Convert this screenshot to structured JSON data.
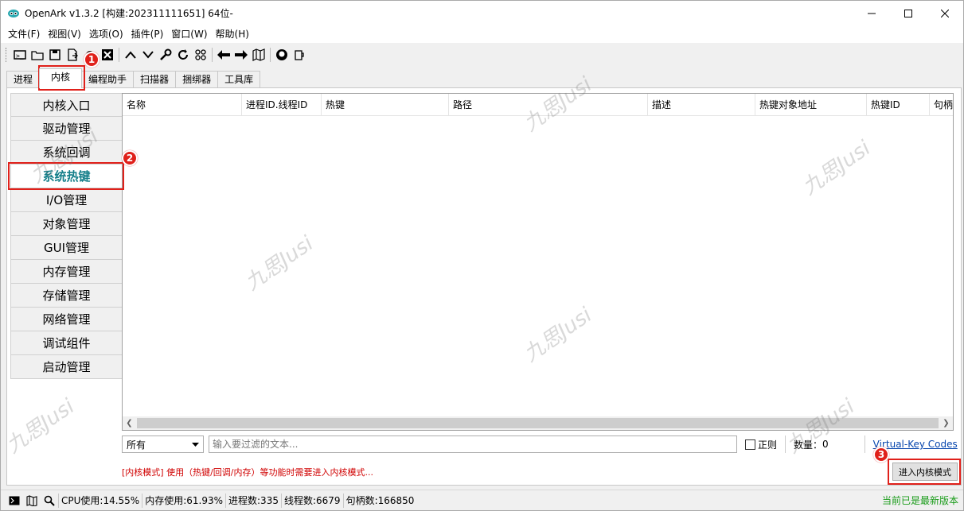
{
  "window": {
    "title": "OpenArk v1.3.2 [构建:202311111651]  64位-"
  },
  "menu": [
    {
      "label": "文件(F)"
    },
    {
      "label": "视图(V)"
    },
    {
      "label": "选项(O)"
    },
    {
      "label": "插件(P)"
    },
    {
      "label": "窗口(W)"
    },
    {
      "label": "帮助(H)"
    }
  ],
  "tabs": [
    {
      "label": "进程"
    },
    {
      "label": "内核"
    },
    {
      "label": "编程助手"
    },
    {
      "label": "扫描器"
    },
    {
      "label": "捆绑器"
    },
    {
      "label": "工具库"
    }
  ],
  "sidenav": [
    {
      "label": "内核入口"
    },
    {
      "label": "驱动管理"
    },
    {
      "label": "系统回调"
    },
    {
      "label": "系统热键"
    },
    {
      "label": "I/O管理"
    },
    {
      "label": "对象管理"
    },
    {
      "label": "GUI管理"
    },
    {
      "label": "内存管理"
    },
    {
      "label": "存储管理"
    },
    {
      "label": "网络管理"
    },
    {
      "label": "调试组件"
    },
    {
      "label": "启动管理"
    }
  ],
  "table": {
    "columns": [
      "名称",
      "进程ID.线程ID",
      "热键",
      "路径",
      "描述",
      "热键对象地址",
      "热键ID",
      "句柄"
    ]
  },
  "filter": {
    "select_value": "所有",
    "placeholder": "输入要过滤的文本...",
    "regex_label": "正则",
    "count_label": "数量：",
    "count_value": "0",
    "vk_link": "Virtual-Key Codes"
  },
  "kernel": {
    "message": "[内核模式] 使用（热键/回调/内存）等功能时需要进入内核模式...",
    "button": "进入内核模式"
  },
  "status": {
    "cpu": "CPU使用:14.55%",
    "mem": "内存使用:61.93%",
    "procs": "进程数:335",
    "threads": "线程数:6679",
    "handles": "句柄数:166850",
    "update": "当前已是最新版本"
  },
  "badges": [
    "1",
    "2",
    "3"
  ],
  "watermark": "九思Jusi",
  "colors": {
    "highlight": "#e0201a",
    "active_nav": "#157f8a",
    "kernel_msg": "#d00000",
    "update_text": "#1a9c1a",
    "link": "#0645ad"
  }
}
